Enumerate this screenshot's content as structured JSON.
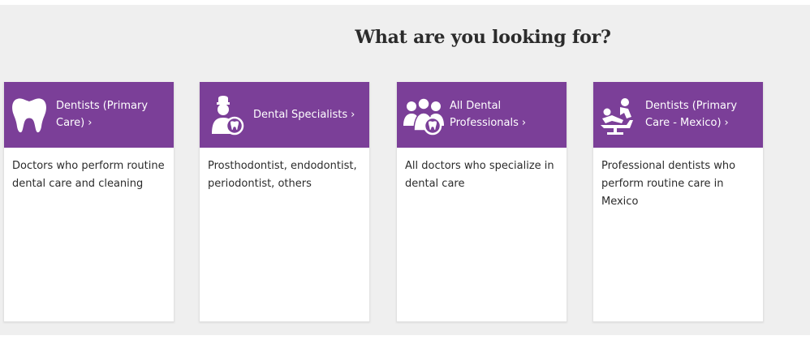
{
  "page": {
    "title": "What are you looking for?"
  },
  "colors": {
    "header_purple": "#7b3f98",
    "panel_bg": "#efefef",
    "card_bg": "#ffffff",
    "text": "#2b2b2b"
  },
  "cards": [
    {
      "label_line1": "Dentists (Primary",
      "label_line2": "Care)",
      "chevron": "›",
      "icon": "tooth-icon",
      "description": "Doctors who perform routine dental care and cleaning"
    },
    {
      "label_line1": "Dental Specialists",
      "label_line2": "",
      "chevron": "›",
      "icon": "dental-specialist-icon",
      "description": "Prosthodontist, endodontist, periodontist, others"
    },
    {
      "label_line1": "All Dental",
      "label_line2": "Professionals",
      "chevron": "›",
      "icon": "dental-team-icon",
      "description": "All doctors who specialize in dental care"
    },
    {
      "label_line1": "Dentists (Primary",
      "label_line2": "Care - Mexico)",
      "chevron": "›",
      "icon": "dentist-chair-icon",
      "description": "Professional dentists who perform routine care in Mexico"
    }
  ]
}
